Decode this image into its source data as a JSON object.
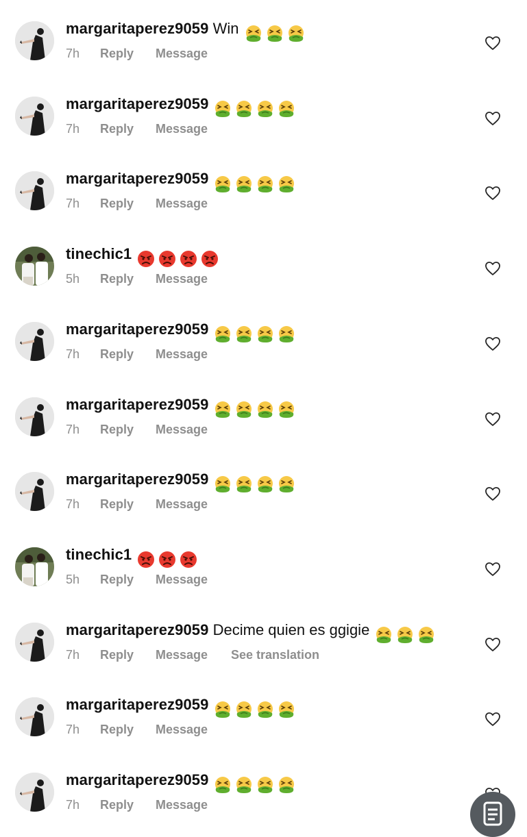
{
  "comments": [
    {
      "username": "margaritaperez9059",
      "text": "Win",
      "emoji": "nauseated-face",
      "emoji_count": 3,
      "avatar": "avatar-dark-dress",
      "time": "7h",
      "reply": "Reply",
      "message": "Message",
      "translation": ""
    },
    {
      "username": "margaritaperez9059",
      "text": "",
      "emoji": "nauseated-face",
      "emoji_count": 4,
      "avatar": "avatar-dark-dress",
      "time": "7h",
      "reply": "Reply",
      "message": "Message",
      "translation": ""
    },
    {
      "username": "margaritaperez9059",
      "text": "",
      "emoji": "nauseated-face",
      "emoji_count": 4,
      "avatar": "avatar-dark-dress",
      "time": "7h",
      "reply": "Reply",
      "message": "Message",
      "translation": ""
    },
    {
      "username": "tinechic1",
      "text": "",
      "emoji": "angry-face",
      "emoji_count": 4,
      "avatar": "avatar-two-people",
      "time": "5h",
      "reply": "Reply",
      "message": "Message",
      "translation": ""
    },
    {
      "username": "margaritaperez9059",
      "text": "",
      "emoji": "nauseated-face",
      "emoji_count": 4,
      "avatar": "avatar-dark-dress",
      "time": "7h",
      "reply": "Reply",
      "message": "Message",
      "translation": ""
    },
    {
      "username": "margaritaperez9059",
      "text": "",
      "emoji": "nauseated-face",
      "emoji_count": 4,
      "avatar": "avatar-dark-dress",
      "time": "7h",
      "reply": "Reply",
      "message": "Message",
      "translation": ""
    },
    {
      "username": "margaritaperez9059",
      "text": "",
      "emoji": "nauseated-face",
      "emoji_count": 4,
      "avatar": "avatar-dark-dress",
      "time": "7h",
      "reply": "Reply",
      "message": "Message",
      "translation": ""
    },
    {
      "username": "tinechic1",
      "text": "",
      "emoji": "angry-face",
      "emoji_count": 3,
      "avatar": "avatar-two-people",
      "time": "5h",
      "reply": "Reply",
      "message": "Message",
      "translation": ""
    },
    {
      "username": "margaritaperez9059",
      "text": "Decime quien es ggigie",
      "emoji": "nauseated-face",
      "emoji_count": 3,
      "avatar": "avatar-dark-dress",
      "time": "7h",
      "reply": "Reply",
      "message": "Message",
      "translation": "See translation"
    },
    {
      "username": "margaritaperez9059",
      "text": "",
      "emoji": "nauseated-face",
      "emoji_count": 4,
      "avatar": "avatar-dark-dress",
      "time": "7h",
      "reply": "Reply",
      "message": "Message",
      "translation": ""
    },
    {
      "username": "margaritaperez9059",
      "text": "",
      "emoji": "nauseated-face",
      "emoji_count": 4,
      "avatar": "avatar-dark-dress",
      "time": "7h",
      "reply": "Reply",
      "message": "Message",
      "translation": ""
    }
  ],
  "heart_icon": "heart-outline-icon",
  "floating_button_icon": "document-scan-icon",
  "colors": {
    "meta_text": "#8e8e8e",
    "username_text": "#111111",
    "heart_stroke": "#262626",
    "fab_background": "#555a5f"
  }
}
